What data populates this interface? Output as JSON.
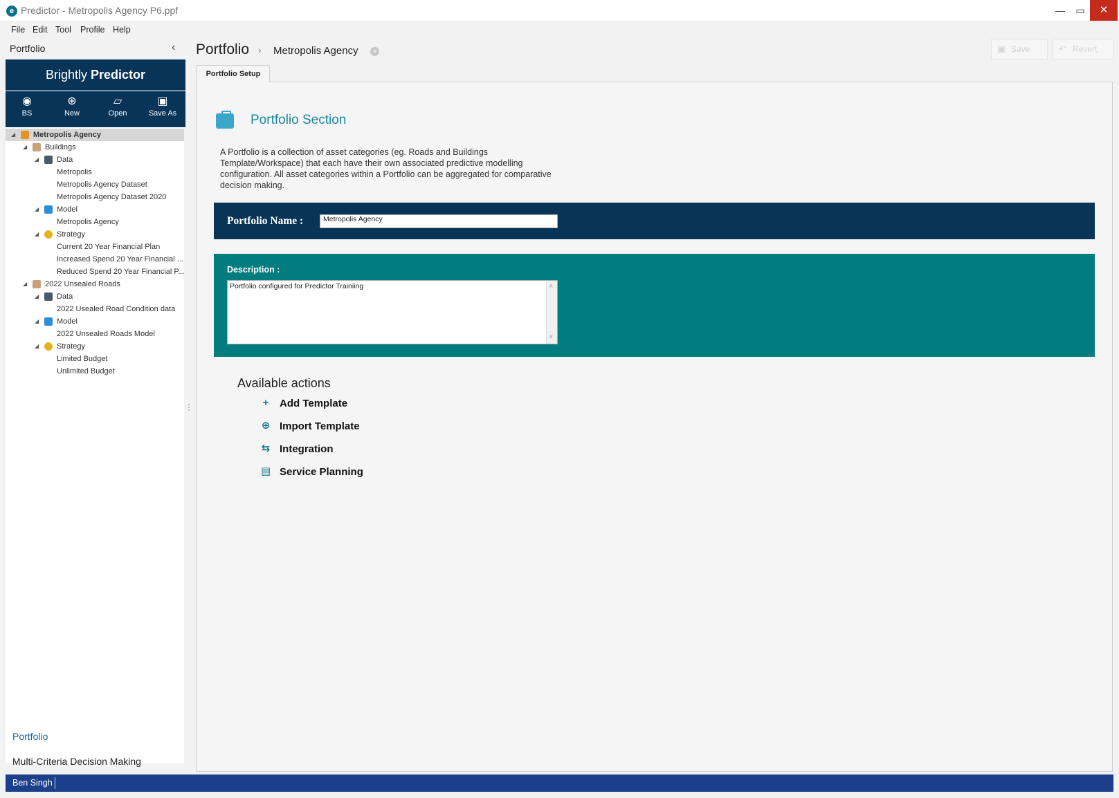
{
  "window": {
    "title": "Predictor - Metropolis Agency P6.ppf",
    "min_glyph": "—",
    "max_glyph": "▭",
    "close_glyph": "✕"
  },
  "menu": [
    "File",
    "Edit",
    "Tool",
    "Profile",
    "Help"
  ],
  "sidebar": {
    "header": "Portfolio",
    "collapse_glyph": "‹",
    "brand_prefix": "Brightly",
    "brand_strong": "Predictor",
    "toolbar": [
      {
        "label": "BS",
        "icon": "user-icon",
        "glyph": "◉"
      },
      {
        "label": "New",
        "icon": "plus-circle-icon",
        "glyph": "⊕"
      },
      {
        "label": "Open",
        "icon": "folder-open-icon",
        "glyph": "▱"
      },
      {
        "label": "Save As",
        "icon": "floppy-icon",
        "glyph": "▣"
      }
    ],
    "tree": [
      {
        "label": "Metropolis Agency",
        "depth": 0,
        "expander": "◢",
        "icon": "briefcase-icon",
        "selected": true,
        "bold": true
      },
      {
        "label": "Buildings",
        "depth": 1,
        "expander": "◢",
        "icon": "category-icon"
      },
      {
        "label": "Data",
        "depth": 2,
        "expander": "◢",
        "icon": "database-icon"
      },
      {
        "label": "Metropolis",
        "depth": 3
      },
      {
        "label": "Metropolis Agency Dataset",
        "depth": 3
      },
      {
        "label": "Metropolis Agency Dataset 2020",
        "depth": 3
      },
      {
        "label": "Model",
        "depth": 2,
        "expander": "◢",
        "icon": "bar-chart-icon"
      },
      {
        "label": "Metropolis Agency",
        "depth": 3
      },
      {
        "label": "Strategy",
        "depth": 2,
        "expander": "◢",
        "icon": "coins-icon"
      },
      {
        "label": "Current 20 Year Financial Plan",
        "depth": 3
      },
      {
        "label": "Increased Spend 20 Year Financial ...",
        "depth": 3
      },
      {
        "label": "Reduced Spend 20 Year Financial P...",
        "depth": 3
      },
      {
        "label": "2022 Unsealed Roads",
        "depth": 1,
        "expander": "◢",
        "icon": "category-icon"
      },
      {
        "label": "Data",
        "depth": 2,
        "expander": "◢",
        "icon": "database-icon"
      },
      {
        "label": "2022 Usealed Road Condition data",
        "depth": 3
      },
      {
        "label": "Model",
        "depth": 2,
        "expander": "◢",
        "icon": "bar-chart-icon"
      },
      {
        "label": "2022 Unsealed Roads Model",
        "depth": 3
      },
      {
        "label": "Strategy",
        "depth": 2,
        "expander": "◢",
        "icon": "coins-icon"
      },
      {
        "label": "Limited Budget",
        "depth": 3
      },
      {
        "label": "Unlimited Budget",
        "depth": 3
      }
    ],
    "nav": {
      "portfolio": "Portfolio",
      "mcdm": "Multi-Criteria Decision Making"
    }
  },
  "breadcrumb": {
    "root": "Portfolio",
    "separator": "›",
    "current": "Metropolis Agency",
    "close_glyph": "×"
  },
  "top_actions": {
    "save": "Save",
    "revert": "Revert",
    "save_glyph": "▣",
    "revert_glyph": "↶"
  },
  "tab": "Portfolio Setup",
  "section": {
    "title": "Portfolio Section",
    "description": "A Portfolio is a collection of asset categories (eg. Roads and Buildings Template/Workspace) that each have their own associated predictive modelling configuration. All asset categories within a Portfolio can be aggregated for comparative decision making."
  },
  "form": {
    "name_label": "Portfolio Name :",
    "name_value": "Metropolis Agency",
    "desc_label": "Description :",
    "desc_value": "Portfolio configured for Predictor Trainiing",
    "scroll_up": "∧",
    "scroll_down": "∨"
  },
  "actions": {
    "title": "Available actions",
    "items": [
      {
        "label": "Add Template",
        "icon": "plus-icon",
        "glyph": "+"
      },
      {
        "label": "Import Template",
        "icon": "import-circle-icon",
        "glyph": "⊕"
      },
      {
        "label": "Integration",
        "icon": "integration-icon",
        "glyph": "⇆"
      },
      {
        "label": "Service Planning",
        "icon": "document-icon",
        "glyph": "▤"
      }
    ]
  },
  "status": {
    "user": "Ben Singh"
  },
  "colors": {
    "navy": "#073457",
    "teal": "#037c80",
    "accent": "#17879f",
    "status": "#1b3f8a"
  }
}
